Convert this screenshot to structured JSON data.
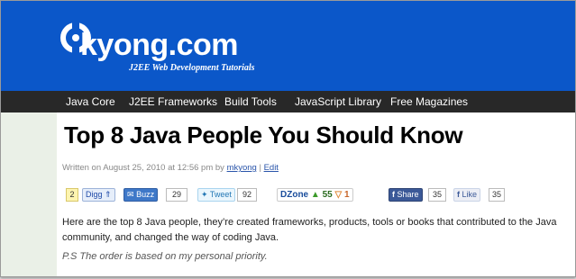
{
  "site": {
    "logo_text": "kyong.com",
    "tagline": "J2EE Web Development Tutorials"
  },
  "nav": {
    "items": [
      "Java Core",
      "J2EE Frameworks",
      "Build Tools",
      "JavaScript Library",
      "Free Magazines"
    ]
  },
  "article": {
    "title": "Top 8 Java People You Should Know",
    "meta_prefix": "Written on August 25, 2010 at 12:56 pm by",
    "author": "mkyong",
    "separator": "|",
    "edit": "Edit",
    "paragraph": "Here are the top 8 Java people, they’re created frameworks, products, tools or books that contributed to the Java community, and changed the way of coding Java.",
    "ps": "P.S The order is based on my personal priority."
  },
  "share": {
    "digg_count": "2",
    "digg_label": "Digg",
    "buzz_label": "Buzz",
    "buzz_count": "29",
    "tweet_label": "Tweet",
    "tweet_count": "92",
    "dzone_label": "DZone",
    "dzone_up": "55",
    "dzone_down": "1",
    "fb_share_label": "Share",
    "fb_share_count": "35",
    "fb_like_label": "Like",
    "fb_like_count": "35"
  },
  "colors": {
    "header_bg": "#0b57c9",
    "nav_bg": "#282828"
  }
}
